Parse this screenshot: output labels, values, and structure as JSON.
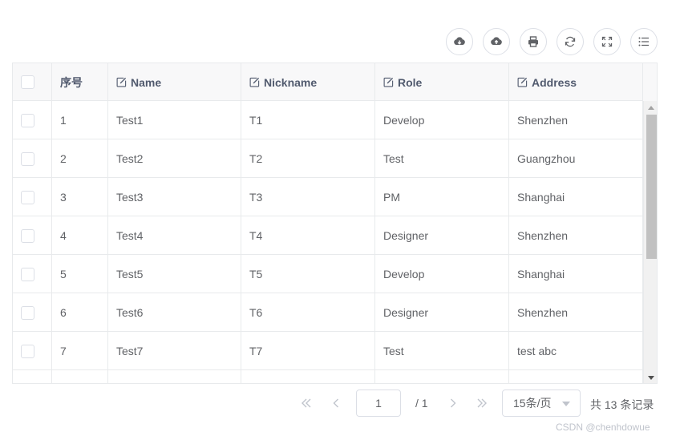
{
  "toolbar": {
    "buttons": [
      {
        "icon": "cloud-download-icon"
      },
      {
        "icon": "cloud-upload-icon"
      },
      {
        "icon": "print-icon"
      },
      {
        "icon": "refresh-icon"
      },
      {
        "icon": "fullscreen-icon"
      },
      {
        "icon": "list-settings-icon"
      }
    ]
  },
  "table": {
    "headers": {
      "seq": "序号",
      "name": "Name",
      "nickname": "Nickname",
      "role": "Role",
      "address": "Address"
    },
    "rows": [
      {
        "seq": "1",
        "name": "Test1",
        "nickname": "T1",
        "role": "Develop",
        "address": "Shenzhen"
      },
      {
        "seq": "2",
        "name": "Test2",
        "nickname": "T2",
        "role": "Test",
        "address": "Guangzhou"
      },
      {
        "seq": "3",
        "name": "Test3",
        "nickname": "T3",
        "role": "PM",
        "address": "Shanghai"
      },
      {
        "seq": "4",
        "name": "Test4",
        "nickname": "T4",
        "role": "Designer",
        "address": "Shenzhen"
      },
      {
        "seq": "5",
        "name": "Test5",
        "nickname": "T5",
        "role": "Develop",
        "address": "Shanghai"
      },
      {
        "seq": "6",
        "name": "Test6",
        "nickname": "T6",
        "role": "Designer",
        "address": "Shenzhen"
      },
      {
        "seq": "7",
        "name": "Test7",
        "nickname": "T7",
        "role": "Test",
        "address": "test abc"
      },
      {
        "seq": "",
        "name": "",
        "nickname": "",
        "role": "",
        "address": ""
      }
    ]
  },
  "pager": {
    "current_page": "1",
    "total_pages": "/ 1",
    "page_size": "15条/页",
    "total": "共 13 条记录"
  },
  "watermark": "CSDN @chenhdowue",
  "colors": {
    "border": "#e8eaec",
    "header_bg": "#f8f8f9",
    "text": "#606266",
    "header_text": "#515a6e"
  }
}
